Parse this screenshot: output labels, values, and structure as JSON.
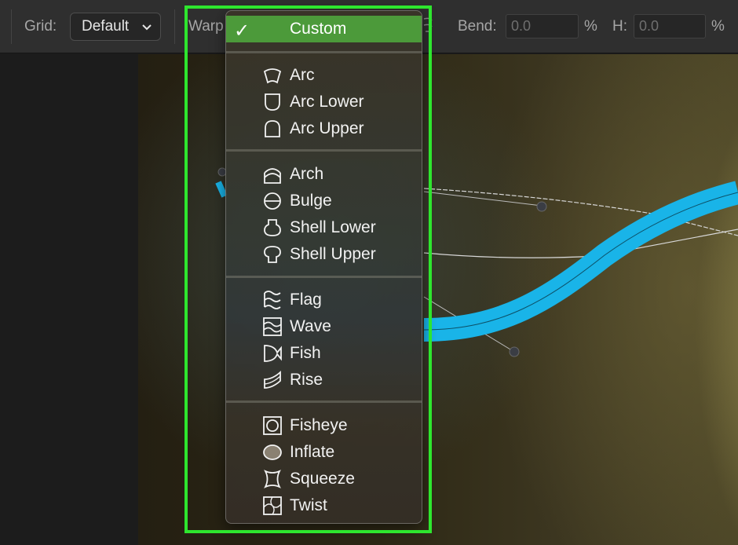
{
  "toolbar": {
    "grid_label": "Grid:",
    "grid_value": "Default",
    "warp_label": "Warp",
    "bend_label": "Bend:",
    "bend_value": "0.0",
    "bend_unit": "%",
    "h_label": "H:",
    "h_value": "0.0",
    "h_unit": "%"
  },
  "menu": {
    "selected": {
      "label": "Custom",
      "check": "✓"
    },
    "groups": [
      [
        {
          "label": "Arc",
          "icon": "arc-icon"
        },
        {
          "label": "Arc Lower",
          "icon": "arc-lower-icon"
        },
        {
          "label": "Arc Upper",
          "icon": "arc-upper-icon"
        }
      ],
      [
        {
          "label": "Arch",
          "icon": "arch-icon"
        },
        {
          "label": "Bulge",
          "icon": "bulge-icon"
        },
        {
          "label": "Shell Lower",
          "icon": "shell-lower-icon"
        },
        {
          "label": "Shell Upper",
          "icon": "shell-upper-icon"
        }
      ],
      [
        {
          "label": "Flag",
          "icon": "flag-icon"
        },
        {
          "label": "Wave",
          "icon": "wave-icon"
        },
        {
          "label": "Fish",
          "icon": "fish-icon"
        },
        {
          "label": "Rise",
          "icon": "rise-icon"
        }
      ],
      [
        {
          "label": "Fisheye",
          "icon": "fisheye-icon"
        },
        {
          "label": "Inflate",
          "icon": "inflate-icon"
        },
        {
          "label": "Squeeze",
          "icon": "squeeze-icon"
        },
        {
          "label": "Twist",
          "icon": "twist-icon"
        }
      ]
    ]
  },
  "colors": {
    "highlight": "#2ee62e",
    "selected_item": "#4c9a3a",
    "warp_stroke": "#19b4e8"
  }
}
